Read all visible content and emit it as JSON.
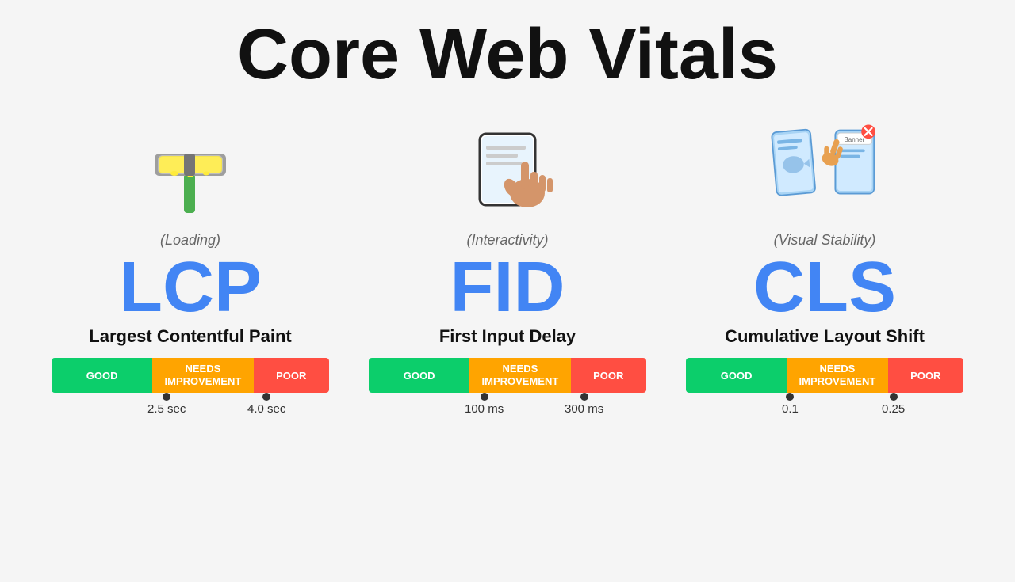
{
  "title": "Core Web Vitals",
  "metrics": [
    {
      "id": "lcp",
      "category": "(Loading)",
      "abbr": "LCP",
      "name": "Largest Contentful Paint",
      "icon_type": "paint-roller",
      "bar": {
        "good_label": "GOOD",
        "needs_label": "NEEDS\nIMPROVEMENT",
        "poor_label": "POOR"
      },
      "tick1_label": "2.5 sec",
      "tick2_label": "4.0 sec"
    },
    {
      "id": "fid",
      "category": "(Interactivity)",
      "abbr": "FID",
      "name": "First Input Delay",
      "icon_type": "finger-tap",
      "bar": {
        "good_label": "GOOD",
        "needs_label": "NEEDS\nIMPROVEMENT",
        "poor_label": "POOR"
      },
      "tick1_label": "100 ms",
      "tick2_label": "300 ms"
    },
    {
      "id": "cls",
      "category": "(Visual Stability)",
      "abbr": "CLS",
      "name": "Cumulative Layout Shift",
      "icon_type": "layout-shift",
      "bar": {
        "good_label": "GOOD",
        "needs_label": "NEEDS\nIMPROVEMENT",
        "poor_label": "POOR"
      },
      "tick1_label": "0.1",
      "tick2_label": "0.25"
    }
  ]
}
